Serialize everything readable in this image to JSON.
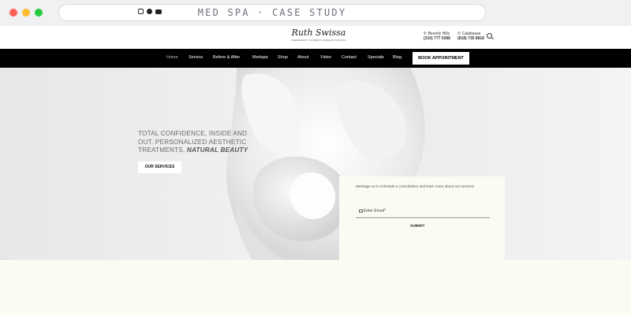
{
  "browser": {
    "title": "MED SPA · CASE STUDY"
  },
  "header": {
    "logo_script": "Ruth Swissa",
    "logo_tagline": "PERMANENT COSMETIC MAKEUP AND SPA",
    "locations": [
      {
        "name": "Beverly Hills",
        "phone": "(310) 777 0288"
      },
      {
        "name": "Calabasas",
        "phone": "(818) 735 8818"
      }
    ]
  },
  "nav": {
    "items": [
      {
        "label": "Home",
        "active": true
      },
      {
        "label": "Service"
      },
      {
        "label": "Before & After"
      },
      {
        "label": "Medspa"
      },
      {
        "label": "Shop"
      },
      {
        "label": "About"
      },
      {
        "label": "Video"
      },
      {
        "label": "Contact"
      },
      {
        "label": "Specials"
      },
      {
        "label": "Blog"
      }
    ],
    "cta": "BOOK APPOINTMENT"
  },
  "hero": {
    "headline": "TOTAL CONFIDENCE, INSIDE AND OUT. PERSONALIZED AESTHETIC TREATMENTS,",
    "headline_em": "NATURAL BEAUTY",
    "button": "OUR SERVICES"
  },
  "form": {
    "message": "Message us to schedule a consultation and learn more about our services",
    "email_placeholder": "Enter Email*",
    "submit": "SUBMIT"
  },
  "colors": {
    "nav_bg": "#000000",
    "form_bg": "#fbfaf3",
    "hero_bg": "#ececec"
  }
}
